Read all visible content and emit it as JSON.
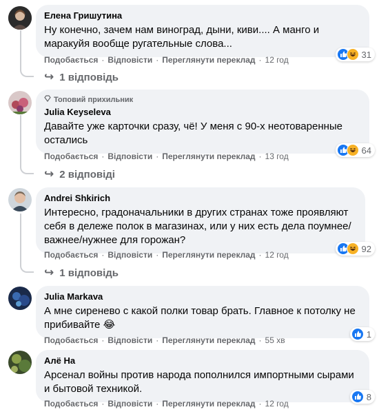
{
  "actions": {
    "like": "Подобається",
    "reply": "Відповісти",
    "translate": "Переглянути переклад",
    "separator": "·"
  },
  "colors": {
    "bubble": "#f0f2f5",
    "secondary_text": "#65676b",
    "like_blue": "#1877f2",
    "haha_yellow": "#f7b125"
  },
  "comments": [
    {
      "author": "Елена Гришутина",
      "text": "Ну конечно, зачем нам виноград, дыни, киви.... А манго и маракуйя вообще ругательные слова...",
      "time": "12 год",
      "reaction_count": "31",
      "reaction_icons": [
        "like-icon",
        "haha-icon"
      ],
      "replies": "1 відповідь"
    },
    {
      "badge": "Топовий прихильник",
      "badge_icon": "diamond-icon",
      "author": "Julia Keyseleva",
      "text": "Давайте уже карточки сразу, чё! У меня с 90-х неотоваренные остались",
      "time": "13 год",
      "reaction_count": "64",
      "reaction_icons": [
        "like-icon",
        "haha-icon"
      ],
      "replies": "2 відповіді"
    },
    {
      "author": "Andrei Shkirich",
      "text": "Интересно, градоначальники в других странах тоже проявляют себя в дележе полок в магазинах, или у них есть дела поумнее/ важнее/нужнее для горожан?",
      "time": "12 год",
      "reaction_count": "92",
      "reaction_icons": [
        "like-icon",
        "haha-icon"
      ],
      "replies": "1 відповідь"
    },
    {
      "author": "Julia Markava",
      "text": "А мне сиренево с какой полки товар брать. Главное к потолку не прибивайте",
      "emoji": "😂",
      "time": "55 хв",
      "reaction_count": "1",
      "reaction_icons": [
        "like-icon"
      ]
    },
    {
      "author": "Алё На",
      "text": "Арсенал войны против народа пополнился импортными сырами и бытовой техникой.",
      "time": "12 год",
      "reaction_count": "8",
      "reaction_icons": [
        "like-icon"
      ]
    }
  ]
}
